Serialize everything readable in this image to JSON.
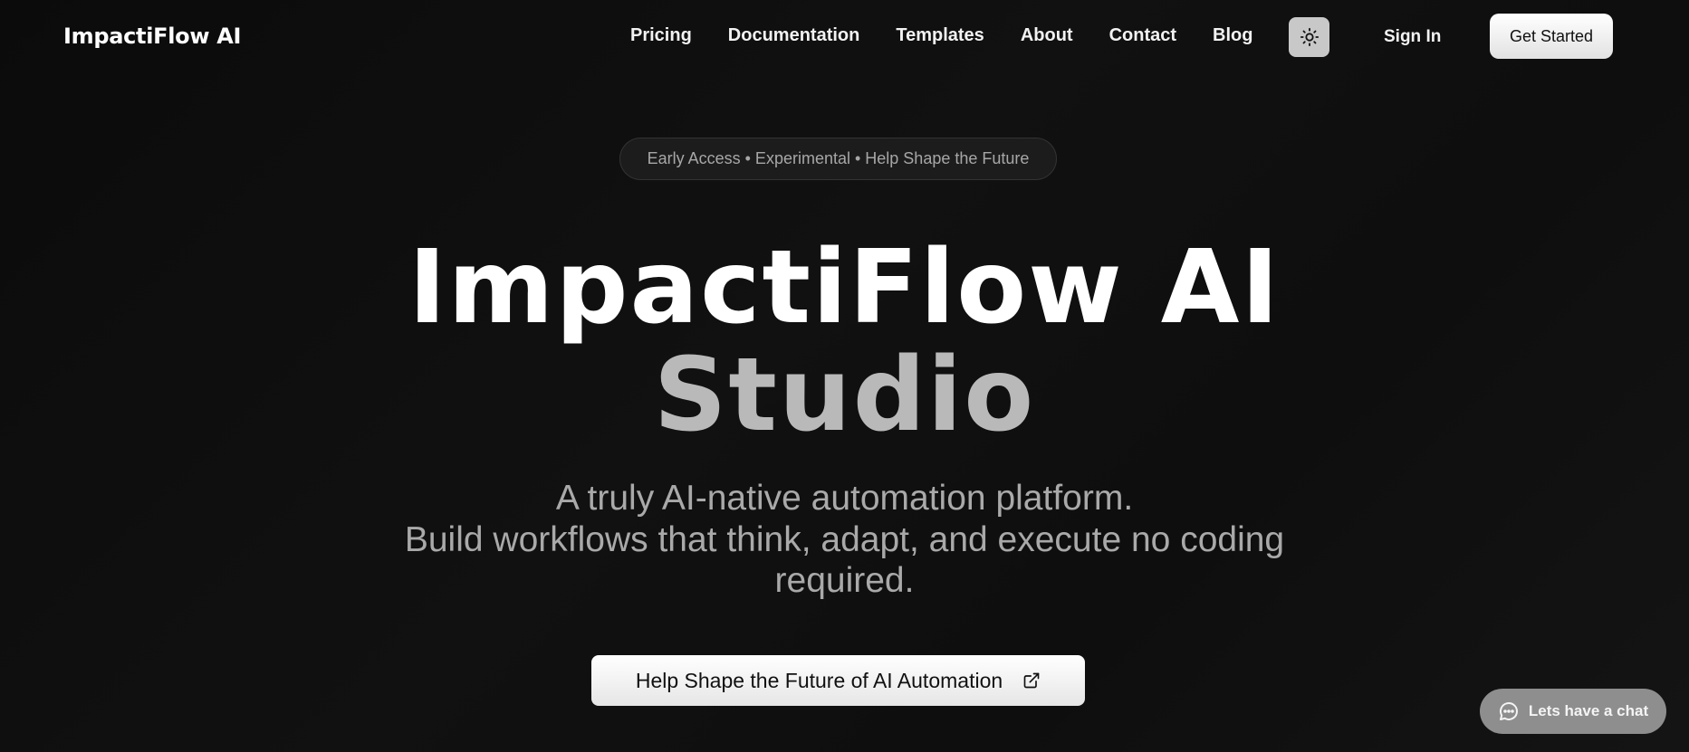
{
  "header": {
    "brand": "ImpactiFlow AI",
    "nav": [
      "Pricing",
      "Documentation",
      "Templates",
      "About",
      "Contact",
      "Blog"
    ],
    "theme_toggle_icon": "sun-icon",
    "sign_in": "Sign In",
    "get_started": "Get Started"
  },
  "hero": {
    "badge": "Early Access • Experimental • Help Shape the Future",
    "title_line1": "ImpactiFlow AI",
    "title_line2": "Studio",
    "subtitle_line1": "A truly AI-native automation platform.",
    "subtitle_line2": "Build workflows that think, adapt, and execute no coding",
    "subtitle_line3": "required.",
    "cta_label": "Help Shape the Future of AI Automation",
    "cta_icon": "external-link-icon"
  },
  "chat_widget": {
    "label": "Lets have a chat",
    "icon": "chat-bubble-icon"
  },
  "colors": {
    "background": "#0d0d0d",
    "title_primary": "#ffffff",
    "title_secondary": "#b9b9b9",
    "chat_bg": "#8e8e8e"
  }
}
